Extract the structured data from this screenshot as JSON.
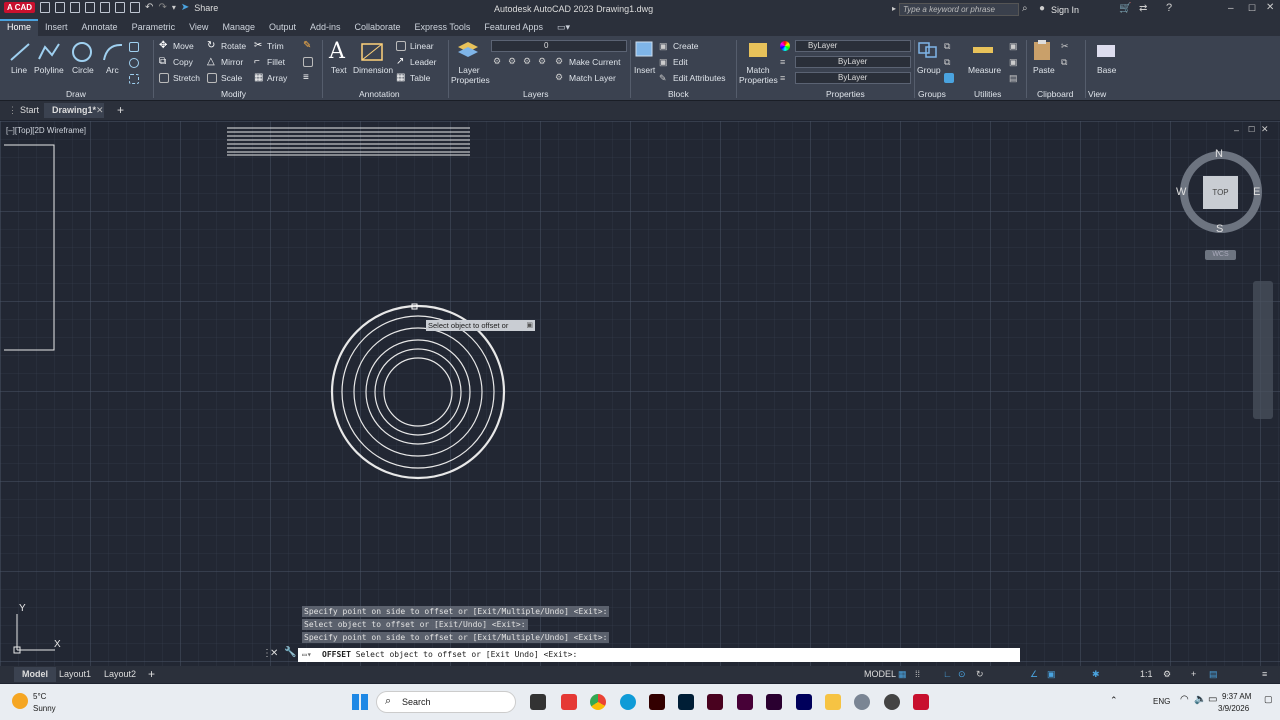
{
  "titlebar": {
    "logo": "A CAD",
    "share": "Share",
    "title": "Autodesk AutoCAD 2023    Drawing1.dwg",
    "search_placeholder": "Type a keyword or phrase",
    "signin": "Sign In"
  },
  "tabs": [
    "Home",
    "Insert",
    "Annotate",
    "Parametric",
    "View",
    "Manage",
    "Output",
    "Add-ins",
    "Collaborate",
    "Express Tools",
    "Featured Apps"
  ],
  "ribbon": {
    "draw": {
      "line": "Line",
      "polyline": "Polyline",
      "circle": "Circle",
      "arc": "Arc",
      "title": "Draw"
    },
    "modify": {
      "move": "Move",
      "rotate": "Rotate",
      "trim": "Trim",
      "copy": "Copy",
      "mirror": "Mirror",
      "fillet": "Fillet",
      "stretch": "Stretch",
      "scale": "Scale",
      "array": "Array",
      "title": "Modify"
    },
    "annotation": {
      "text": "Text",
      "dimension": "Dimension",
      "linear": "Linear",
      "leader": "Leader",
      "table": "Table",
      "title": "Annotation"
    },
    "layers": {
      "layer_properties": "Layer Properties",
      "layer_value": "0",
      "make_current": "Make Current",
      "match_layer": "Match Layer",
      "title": "Layers"
    },
    "block": {
      "insert": "Insert",
      "create": "Create",
      "edit": "Edit",
      "edit_attributes": "Edit Attributes",
      "title": "Block"
    },
    "properties": {
      "match": "Match Properties",
      "color": "ByLayer",
      "linetype": "ByLayer",
      "lineweight": "ByLayer",
      "title": "Properties"
    },
    "groups": {
      "group": "Group",
      "title": "Groups"
    },
    "utilities": {
      "measure": "Measure",
      "title": "Utilities"
    },
    "clipboard": {
      "paste": "Paste",
      "title": "Clipboard"
    },
    "view": {
      "base": "Base",
      "title": "View"
    }
  },
  "filetabs": {
    "start": "Start",
    "drawing": "Drawing1*"
  },
  "viewport": {
    "label": "[–][Top][2D Wireframe]",
    "tooltip": "Select object to offset or",
    "viewcube": {
      "n": "N",
      "s": "S",
      "e": "E",
      "w": "W",
      "top": "TOP",
      "wcs": "WCS"
    },
    "ucs": {
      "x": "X",
      "y": "Y"
    }
  },
  "command": {
    "history": [
      "Specify point on side to offset or [Exit/Multiple/Undo] <Exit>:",
      "Select object to offset or [Exit/Undo] <Exit>:",
      "Specify point on side to offset or [Exit/Multiple/Undo] <Exit>:"
    ],
    "name": "OFFSET",
    "prompt": "Select object to offset or [Exit Undo] <Exit>:"
  },
  "layouts": {
    "model": "Model",
    "layout1": "Layout1",
    "layout2": "Layout2"
  },
  "status": {
    "model": "MODEL",
    "scale": "1:1"
  },
  "taskbar": {
    "temp": "5°C",
    "weather": "Sunny",
    "search": "Search",
    "lang": "ENG",
    "time": "9:37 AM",
    "date": "3/9/2026"
  },
  "colors": {
    "accent": "#4aa3df",
    "autocad_red": "#c8102e",
    "canvas": "#222733"
  }
}
